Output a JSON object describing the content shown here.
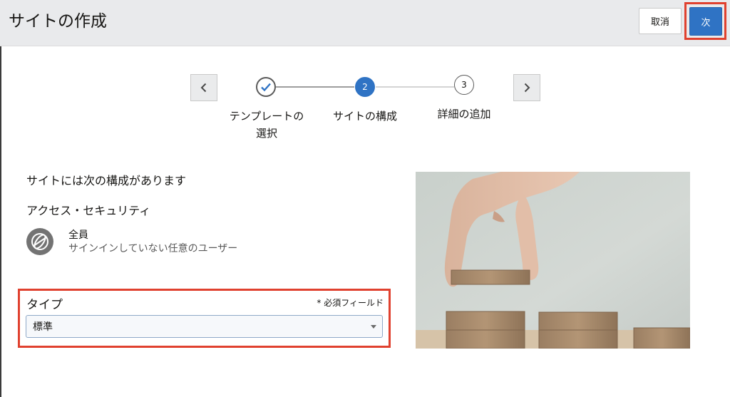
{
  "header": {
    "title": "サイトの作成",
    "cancel_label": "取消",
    "next_label": "次"
  },
  "train": {
    "steps": [
      {
        "number": "1",
        "label": "テンプレートの\n選択",
        "state": "complete"
      },
      {
        "number": "2",
        "label": "サイトの構成",
        "state": "current"
      },
      {
        "number": "3",
        "label": "詳細の追加",
        "state": "upcoming"
      }
    ]
  },
  "content": {
    "config_heading": "サイトには次の構成があります",
    "access_heading": "アクセス・セキュリティ",
    "access_member": {
      "icon": "globe-icon",
      "name": "全員",
      "description": "サインインしていない任意のユーザー"
    },
    "type_field": {
      "label": "タイプ",
      "required_note": "* 必須フィールド",
      "value": "標準"
    }
  },
  "colors": {
    "accent": "#2f73c4",
    "highlight": "#e0412f",
    "header_bg": "#e9eaec"
  }
}
